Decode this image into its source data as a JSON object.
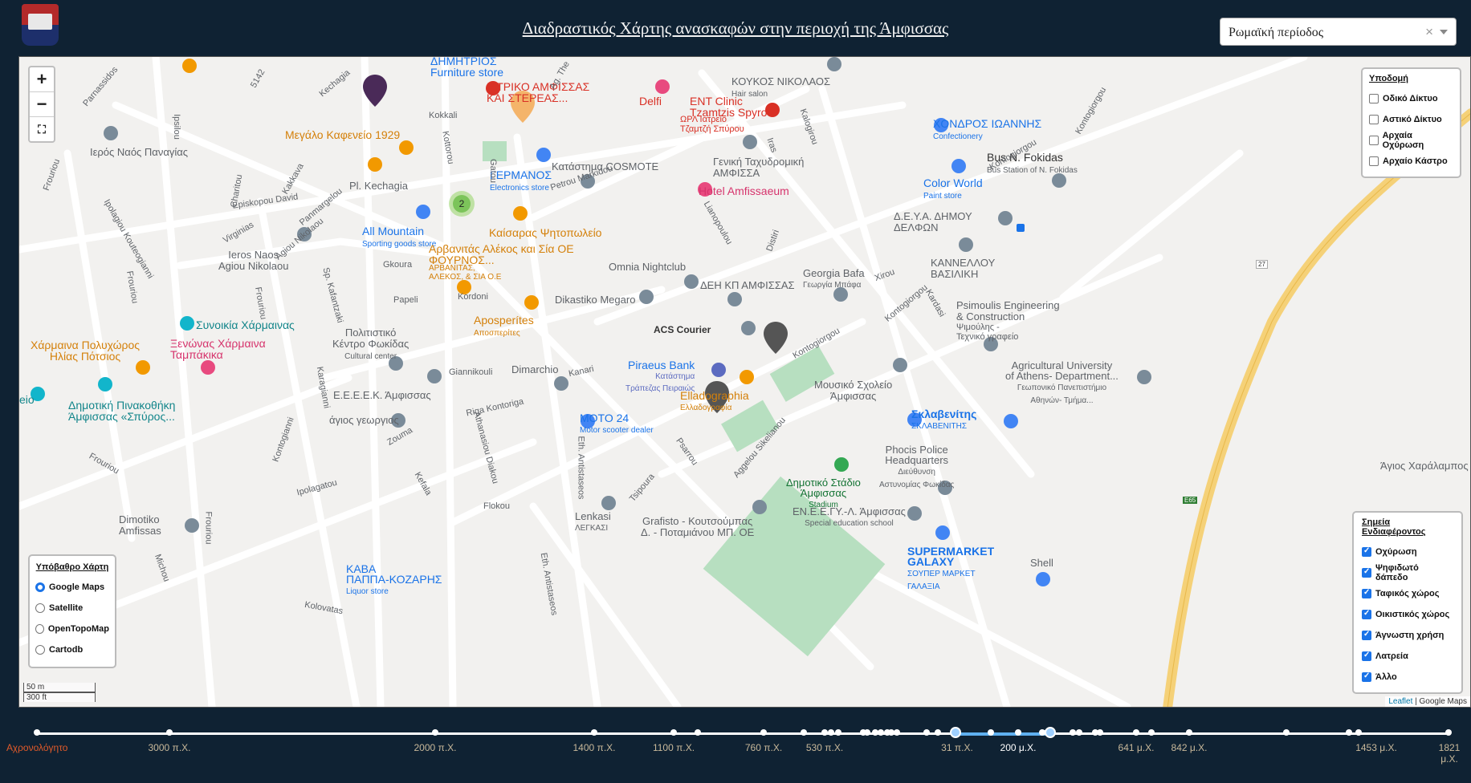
{
  "header": {
    "title": "Διαδραστικός Χάρτης ανασκαφών στην περιοχή της Άμφισσας",
    "period_select": {
      "value": "Ρωμαϊκή περίοδος",
      "clear": "×"
    }
  },
  "map": {
    "zoom": {
      "in": "+",
      "out": "−",
      "fullscreen": "⛶"
    },
    "cluster_count": "2",
    "labels": {
      "furniture": "ΔΗΜΗΤΡΙΟΣ",
      "furniture_sub": "Furniture store",
      "koukos": "ΚΟΥΚΟΣ ΝΙΚΟΛΑΟΣ",
      "koukos_sub": "Hair salon",
      "iatriko": "ΙΑΤΡΙΚΟ ΑΜΦΙΣΣΑΣ",
      "iatriko2": "ΚΑΙ ΣΤΕΡΕΑΣ...",
      "delfi": "Delfi",
      "ent": "ENT Clinic",
      "ent2": "Tzamtzis Spyrou",
      "ent3": "ΩΡΛ Ιατρείο",
      "ent4": "Τζαμτζή Σπύρου",
      "kafeneio": "Μεγάλο Καφενείο 1929",
      "germanos": "ΓΕΡΜΑΝΟΣ",
      "germanos_sub": "Electronics store",
      "cosmote": "Κατάστημα COSMOTE",
      "tachydromeio": "Γενική Ταχυδρομική",
      "tachydromeio2": "ΑΜΦΙΣΣΑ",
      "hotel": "Hotel Amfissaeum",
      "chondros": "ΧΟΝΔΡΟΣ ΙΩΑΝΝΗΣ",
      "chondros_sub": "Confectionery",
      "bus": "Bus N. Fokidas",
      "bus_sub": "Bus Station of N. Fokidas",
      "colorworld": "Color World",
      "colorworld_sub": "Paint store",
      "deya": "Δ.Ε.Υ.Α. ΔΗΜΟΥ",
      "deya2": "ΔΕΛΦΩΝ",
      "naos": "Ιερός Ναός Παναγίας",
      "kechagia": "Pl. Kechagia",
      "allmountain": "All Mountain",
      "allmountain_sub": "Sporting goods store",
      "kaisaras": "Καίσαρας Ψητοπωλείο",
      "arvanitas": "Αρβανιτάς Αλέκος και Σία ΟΕ",
      "arvanitas2": "ΦΟΥΡΝΟΣ...",
      "arvanitas3": "ΑΡΒΑΝΙΤΑΣ,",
      "arvanitas4": "ΑΛΕΚΟΣ, & ΣΙΑ Ο.Ε",
      "omnia": "Omnia Nightclub",
      "georgia": "Georgia Bafa",
      "georgia_sub": "Γεωργία Μπάφα",
      "kannellou": "ΚΑΝΝΕΛΛΟΥ",
      "kannellou2": "ΒΑΣΙΛΙΚΗ",
      "deh": "ΔΕΗ ΚΠ ΑΜΦΙΣΣΑΣ",
      "pimoulis": "Psimoulis Engineering",
      "pimoulis2": "& Construction",
      "pimoulis3": "Ψιμούλης -",
      "pimoulis4": "Τεχνικό γραφείο",
      "nikolaou": "Ieros Naos",
      "nikolaou2": "Agiou Nikolaou",
      "dikastiko": "Dikastiko Megaro",
      "acs": "ACS Courier",
      "aposperites": "Aposperítes",
      "aposperites_sub": "Αποσπερίτες",
      "synoikia": "Συνοικία Χάρμαινας",
      "charmaina": "Χάρμαινα Πολυχώρος",
      "charmaina2": "Ηλίας Πότσιος",
      "xenonas": "Ξενώνας Χάρμαινα",
      "xenonas2": "Ταμπάκικα",
      "politistiko": "Πολιτιστικό",
      "politistiko2": "Κέντρο Φωκίδας",
      "politistiko_sub": "Cultural center",
      "piraeus": "Piraeus Bank",
      "piraeus2": "Κατάστημα",
      "piraeus3": "Τράπεζας Πειραιώς",
      "ellado": "Elladographia",
      "ellado_sub": "Ελλαδογραφία",
      "mousiko": "Μουσικό Σχολείο",
      "mousiko2": "Άμφισσας",
      "agricultural": "Agricultural University",
      "agricultural2": "of Athens- Department...",
      "agricultural3": "Γεωπονικό Πανεπιστήμιο",
      "agricultural4": "Αθηνών- Τμήμα...",
      "eeeek": "Ε.Ε.Ε.Ε.Κ. Άμφισσας",
      "dimarchio": "Dimarchio",
      "sklavenitis": "Σκλαβενίτης",
      "sklavenitis_sub": "ΣΚΛΑΒΕΝΙΤΗΣ",
      "pinakothiki": "Δημοτική Πινακοθήκη",
      "pinakothiki2": "Άμφισσας «Σπύρος...",
      "georgios": "άγιος γεωργιος",
      "moto": "MOTO 24",
      "moto_sub": "Motor scooter dealer",
      "police": "Phocis Police",
      "police2": "Headquarters",
      "police3": "Διεύθυνση",
      "police4": "Αστυνομίας Φωκίδας",
      "stadio": "Δημοτικό Στάδιο",
      "stadio2": "Άμφισσας",
      "stadio_sub": "Stadium",
      "eneegy": "ΕΝ.Ε.Ε.ΓΥ.-Λ. Άμφισσας",
      "eneegy_sub": "Special education school",
      "lenkasi": "Lenkasi",
      "lenkasi_sub": "ΛΕΓΚΑΣΙ",
      "grafisto": "Grafisto - Κουτσούμπας",
      "grafisto2": "Δ. - Ποταμιάνου ΜΠ. ΟΕ",
      "supermarket": "SUPERMARKET",
      "supermarket2": "GALAXY",
      "supermarket3": "ΣΟΥΠΕΡ ΜΑΡΚΕΤ",
      "supermarket4": "ΓΑΛΑΞΙΑ",
      "shell": "Shell",
      "dimotiko": "Dimotiko",
      "dimotiko2": "Amfissas",
      "kava": "ΚΑΒΑ",
      "kava2": "ΠΑΠΠΑ-ΚΟΖΑΡΗΣ",
      "kava_sub": "Liquor store",
      "charalampos": "Άγιος Χαράλαμπος",
      "eio": "eio",
      "route27": "27",
      "routeE65": "E65",
      "streets": {
        "kechagia_st": "Kechagia",
        "kokkali": "Kokkali",
        "gatou": "Gatou",
        "kottorou": "Kottorou",
        "petrou": "Petrou Markidou",
        "episkopou": "Episkopou David",
        "panmargelou": "Panmargelou",
        "virginias": "Virginias",
        "gkoura": "Gkoura",
        "papeli": "Papeli",
        "kordoni": "Kordoni",
        "kanari": "Kanari",
        "giannikouli": "Giannikouli",
        "riga": "Riga Kontoriga",
        "zouma": "Zouma",
        "kefala": "Kefala",
        "flokou": "Flokou",
        "lianopoulou": "Lianopoulou",
        "distiri": "Distiri",
        "xirou": "Xirou",
        "kontogiorgou": "Kontogiorgou",
        "kardasi": "Kardasi",
        "iras": "Iras",
        "kaloigiou": "Kalogirou",
        "psarrou": "Psarrou",
        "tsipoura": "Tsipoura",
        "agg": "Aggelou Sikelianou",
        "ipolagatou": "Ipolagatou",
        "kolovatas": "Kolovatas",
        "parnassidos": "Parnassidos",
        "ipsilou": "Ipsilou",
        "frouriou": "Frouriou",
        "kouteogianni": "Ipolagiou Kouteogianni",
        "agiounikolaou": "Agiou Nikolaou",
        "kafantzaki": "Sp. Kafantzaki",
        "karagianni": "Karagianni",
        "michou": "Michou",
        "kontogianni": "Kontogianni",
        "athanasiou": "Athanasiou Diakou",
        "antistaseos": "Eth. Antistaseos",
        "ag": "Ag. The",
        "charitou": "Charitou",
        "kakkava": "Kakkava",
        "num5142": "5142"
      }
    },
    "layers_panel": {
      "title": "Υποδομή",
      "items": [
        "Οδικό Δίκτυο",
        "Αστικό Δίκτυο",
        "Αρχαία Οχύρωση",
        "Αρχαίο Κάστρο"
      ],
      "checked": [
        false,
        false,
        false,
        false
      ]
    },
    "poi_panel": {
      "title": "Σημεία Ενδιαφέροντος",
      "items": [
        "Οχύρωση",
        "Ψηφιδωτό δάπεδο",
        "Ταφικός χώρος",
        "Οικιστικός χώρος",
        "Άγνωστη χρήση",
        "Λατρεία",
        "Άλλο"
      ],
      "checked": [
        true,
        true,
        true,
        true,
        true,
        true,
        true
      ]
    },
    "base_panel": {
      "title": "Υπόβαθρο Χάρτη",
      "items": [
        "Google Maps",
        "Satellite",
        "OpenTopoMap",
        "Cartodb"
      ],
      "selected": "Google Maps"
    },
    "scale": {
      "metric": "50 m",
      "imperial": "300 ft"
    },
    "attribution": {
      "leaflet": "Leaflet",
      "sep": " | ",
      "provider": "Google Maps"
    }
  },
  "timeline": {
    "labels": [
      "Αχρονολόγητο",
      "3000 π.Χ.",
      "2000 π.Χ.",
      "1400 π.Χ.",
      "1100 π.Χ.",
      "760 π.Χ.",
      "530 π.Χ.",
      "31 π.Χ.",
      "200 μ.Χ.",
      "641 μ.Χ.",
      "842 μ.Χ.",
      "1453 μ.Χ.",
      "1821 μ.Χ."
    ],
    "selected_range": [
      "31 π.Χ.",
      "641 μ.Χ."
    ],
    "colors": {
      "undated": "#e05a2a",
      "label": "#c8b89a",
      "range": "#5fb0f0"
    }
  }
}
